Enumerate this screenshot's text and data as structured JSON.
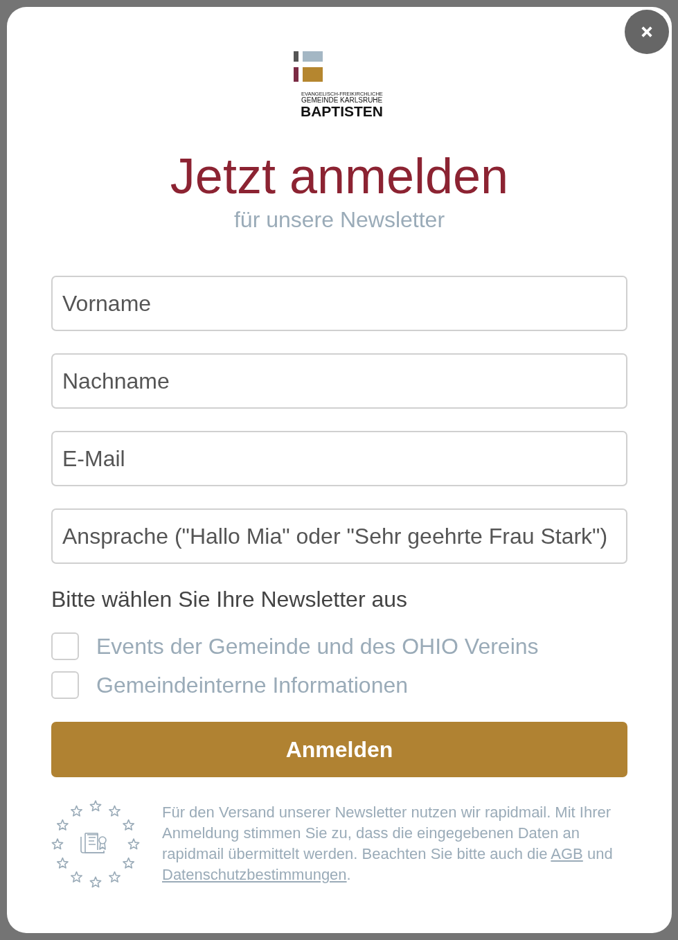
{
  "logo": {
    "lines": [
      "EVANGELISCH-FREIKIRCHLICHE",
      "GEMEINDE KARLSRUHE"
    ],
    "name": "BAPTISTEN"
  },
  "title": "Jetzt anmelden",
  "subtitle": "für unsere Newsletter",
  "fields": [
    {
      "placeholder": "Vorname"
    },
    {
      "placeholder": "Nachname"
    },
    {
      "placeholder": "E-Mail"
    },
    {
      "placeholder": "Ansprache (\"Hallo Mia\" oder \"Sehr geehrte Frau Stark\")"
    }
  ],
  "newsletter_prompt": "Bitte wählen Sie Ihre Newsletter aus",
  "newsletters": [
    {
      "label": "Events der Gemeinde und des OHIO Vereins",
      "checked": false
    },
    {
      "label": "Gemeindeinterne Informationen",
      "checked": false
    }
  ],
  "submit_button": "Anmelden",
  "privacy_notice": [
    {
      "kind": "text",
      "text": "Für den Versand unserer Newsletter nutzen wir rapidmail. Mit Ihrer Anmeldung stimmen Sie zu, dass die eingegebenen Daten an rapidmail übermittelt werden. Beachten Sie bitte auch die "
    },
    {
      "kind": "link",
      "text": "AGB"
    },
    {
      "kind": "text",
      "text": " und "
    },
    {
      "kind": "link",
      "text": "Datenschutzbestimmungen"
    },
    {
      "kind": "text",
      "text": "."
    }
  ]
}
